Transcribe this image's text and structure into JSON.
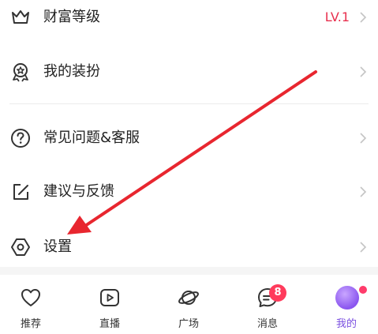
{
  "menu": {
    "wealth": {
      "label": "财富等级",
      "value": "LV.1",
      "icon": "crown-icon"
    },
    "outfit": {
      "label": "我的装扮",
      "icon": "badge-icon"
    },
    "faq": {
      "label": "常见问题&客服",
      "icon": "question-icon"
    },
    "feedback": {
      "label": "建议与反馈",
      "icon": "edit-icon"
    },
    "settings": {
      "label": "设置",
      "icon": "hexagon-icon"
    }
  },
  "tabs": [
    {
      "label": "推荐",
      "icon": "heart-icon"
    },
    {
      "label": "直播",
      "icon": "play-icon"
    },
    {
      "label": "广场",
      "icon": "planet-icon"
    },
    {
      "label": "消息",
      "icon": "chat-icon",
      "badge": "8"
    },
    {
      "label": "我的",
      "icon": "avatar-icon",
      "active": true
    }
  ],
  "colors": {
    "accent": "#7a4fe0",
    "level": "#e8304e",
    "badge": "#ff3b5c",
    "arrow": "#e8262f"
  }
}
